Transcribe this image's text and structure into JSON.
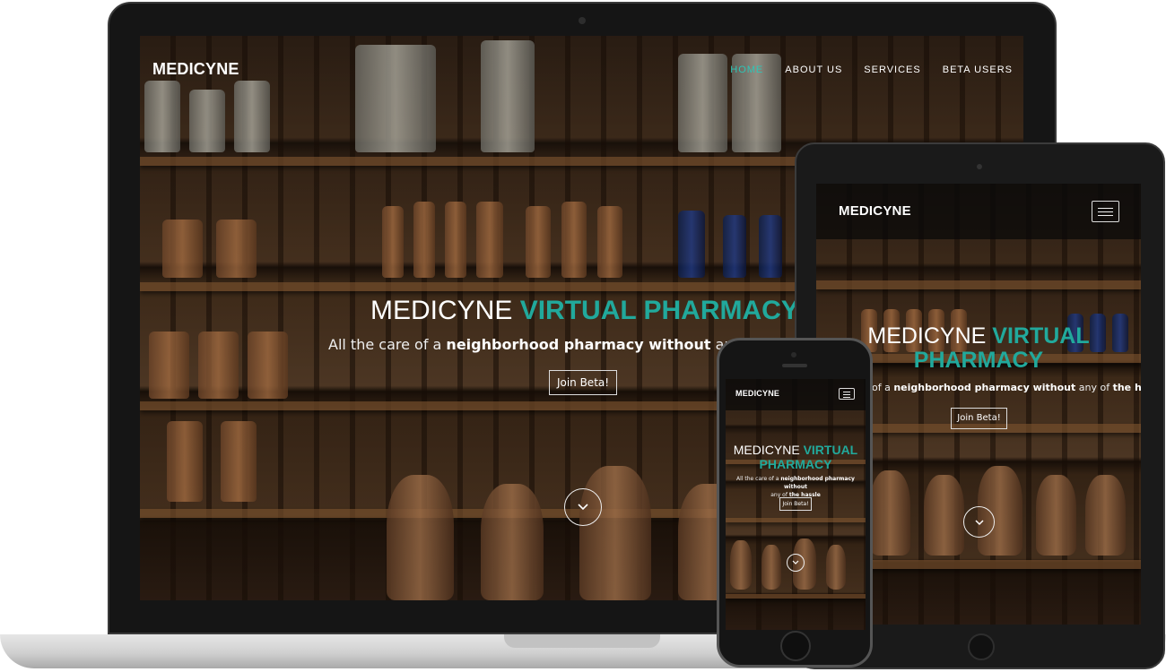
{
  "site": {
    "brand": "MEDICYNE",
    "nav": [
      "HOME",
      "ABOUT US",
      "SERVICES",
      "BETA USERS"
    ],
    "title_plain": "MEDICYNE",
    "title_accent": "VIRTUAL PHARMACY",
    "subtitle_pre": "All the care of a ",
    "subtitle_bold1": "neighborhood pharmacy without",
    "subtitle_mid": " any of ",
    "subtitle_bold2": "the hassle",
    "cta": "Join Beta!"
  },
  "laptop": {
    "subtitle_pre": "All the care of a ",
    "subtitle_bold1": "neighborhood pharmacy without",
    "subtitle_mid": " an"
  },
  "tablet": {
    "title_line2": "PHARMACY",
    "subtitle_pre": "of a ",
    "subtitle_bold1": "neighborhood pharmacy without",
    "subtitle_mid": " any of ",
    "subtitle_bold2": "the hassle"
  },
  "phone": {
    "title_line2": "PHARMACY",
    "subtitle_line1_pre": "All the care of a ",
    "subtitle_line1_bold": "neighborhood pharmacy without",
    "subtitle_line2_mid": "any of ",
    "subtitle_line2_bold": "the hassle"
  },
  "colors": {
    "accent": "#21a99c",
    "active_nav": "#2ec4b6"
  },
  "icons": {
    "scroll": "chevron-down-icon",
    "menu": "hamburger-icon"
  }
}
